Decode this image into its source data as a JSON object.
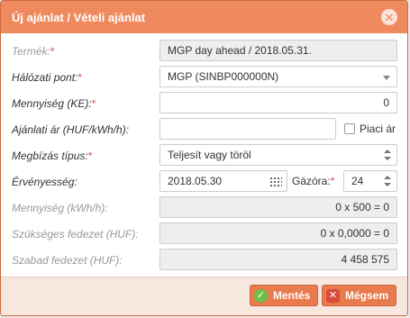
{
  "dialog": {
    "title": "Új ajánlat / Vételi ajánlat",
    "close_glyph": "✕"
  },
  "form": {
    "product": {
      "label": "Termék:",
      "required": "*",
      "value": "MGP day ahead / 2018.05.31."
    },
    "network_point": {
      "label": "Hálózati pont:",
      "required": "*",
      "value": "MGP (SINBP000000N)"
    },
    "quantity": {
      "label": "Mennyiség (KE):",
      "required": "*",
      "value": "0"
    },
    "price": {
      "label": "Ajánlati ár (HUF/kWh/h):",
      "value": "",
      "market_price_label": "Piaci ár"
    },
    "order_type": {
      "label": "Megbízás típus:",
      "required": "*",
      "value": "Teljesít vagy töröl"
    },
    "validity": {
      "label": "Érvényesség:",
      "value": "2018.05.30",
      "hour_label": "Gázóra:",
      "hour_required": "*",
      "hour_value": "24"
    },
    "quantity_kwh": {
      "label": "Mennyiség (kWh/h):",
      "value": "0 x 500 = 0"
    },
    "required_cover": {
      "label": "Szükséges fedezet (HUF):",
      "value": "0 x 0,0000 = 0"
    },
    "free_cover": {
      "label": "Szabad fedezet (HUF):",
      "value": "4 458 575"
    }
  },
  "footer": {
    "save_label": "Mentés",
    "cancel_label": "Mégsem",
    "save_icon": "check-circle-icon",
    "cancel_icon": "x-square-icon"
  },
  "colors": {
    "titlebar": "#ef8a5f",
    "button": "#e87a4c",
    "required": "#d9534f"
  }
}
